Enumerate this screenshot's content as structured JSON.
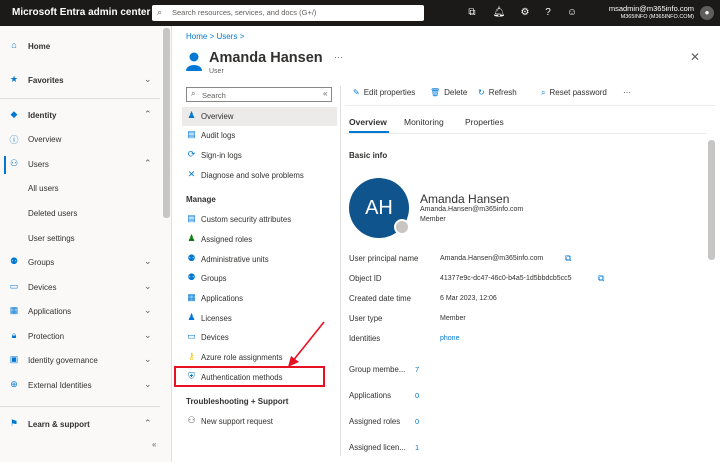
{
  "topbar": {
    "app_title": "Microsoft Entra admin center",
    "search_placeholder": "Search resources, services, and docs (G+/)",
    "icons": [
      "feedback-icon",
      "bell-icon",
      "gear-icon",
      "help-icon",
      "person-feedback-icon"
    ],
    "account_name": "msadmin@m365info.com",
    "account_org": "M365INFO (M365INFO.COM)"
  },
  "leftnav": {
    "items": [
      {
        "label": "Home",
        "icon": "home-icon",
        "chevron": ""
      },
      {
        "label": "Favorites",
        "icon": "star-icon",
        "chevron": "⌄"
      },
      {
        "label": "Identity",
        "icon": "diamond-icon",
        "chevron": "⌃"
      },
      {
        "label": "Overview",
        "icon": "info-circle-icon",
        "chevron": ""
      },
      {
        "label": "Users",
        "icon": "user-icon",
        "chevron": "⌃"
      },
      {
        "label": "All users",
        "icon": "",
        "chevron": ""
      },
      {
        "label": "Deleted users",
        "icon": "",
        "chevron": ""
      },
      {
        "label": "User settings",
        "icon": "",
        "chevron": ""
      },
      {
        "label": "Groups",
        "icon": "group-icon",
        "chevron": "⌄"
      },
      {
        "label": "Devices",
        "icon": "devices-icon",
        "chevron": "⌄"
      },
      {
        "label": "Applications",
        "icon": "applications-icon",
        "chevron": "⌄"
      },
      {
        "label": "Protection",
        "icon": "lock-icon",
        "chevron": "⌄"
      },
      {
        "label": "Identity governance",
        "icon": "governance-icon",
        "chevron": "⌄"
      },
      {
        "label": "External Identities",
        "icon": "external-icon",
        "chevron": "⌄"
      },
      {
        "label": "Learn & support",
        "icon": "learn-icon",
        "chevron": "⌃"
      }
    ],
    "collapse_glyph": "«"
  },
  "breadcrumb": "Home  >  Users  >",
  "page": {
    "title": "Amanda Hansen",
    "subtitle": "User",
    "more": "···",
    "close": "✕"
  },
  "resource_menu": {
    "search_placeholder": "Search",
    "collapse": "«",
    "items_top": [
      "Overview",
      "Audit logs",
      "Sign-in logs",
      "Diagnose and solve problems"
    ],
    "manage_heading": "Manage",
    "manage_items": [
      "Custom security attributes",
      "Assigned roles",
      "Administrative units",
      "Groups",
      "Applications",
      "Licenses",
      "Devices",
      "Azure role assignments",
      "Authentication methods"
    ],
    "troubleshoot_heading": "Troubleshooting + Support",
    "troubleshoot_items": [
      "New support request"
    ]
  },
  "toolbar": {
    "edit": "Edit properties",
    "delete": "Delete",
    "refresh": "Refresh",
    "reset": "Reset password",
    "more": "···"
  },
  "tabs": [
    "Overview",
    "Monitoring",
    "Properties"
  ],
  "basic_info": {
    "heading": "Basic info",
    "initials": "AH",
    "name": "Amanda Hansen",
    "email": "Amanda.Hansen@m365info.com",
    "user_type_caption": "Member",
    "properties": [
      {
        "label": "User principal name",
        "value": "Amanda.Hansen@m365info.com",
        "link": false,
        "copy": true
      },
      {
        "label": "Object ID",
        "value": "41377e9c-dc47-46c0-b4a5-1d5bbdcb5cc5",
        "link": false,
        "copy": true
      },
      {
        "label": "Created date time",
        "value": "6 Mar 2023, 12:06",
        "link": false,
        "copy": false
      },
      {
        "label": "User type",
        "value": "Member",
        "link": false,
        "copy": false
      },
      {
        "label": "Identities",
        "value": "phone",
        "link": true,
        "copy": false
      }
    ],
    "cards": [
      {
        "label": "Group membe...",
        "value": "7"
      },
      {
        "label": "Applications",
        "value": "0"
      },
      {
        "label": "Assigned roles",
        "value": "0"
      },
      {
        "label": "Assigned licen...",
        "value": "1"
      }
    ]
  },
  "colors": {
    "accent": "#0078d4",
    "topbar": "#1b1a19",
    "highlight": "#e81123",
    "avatar": "#0f548c"
  }
}
